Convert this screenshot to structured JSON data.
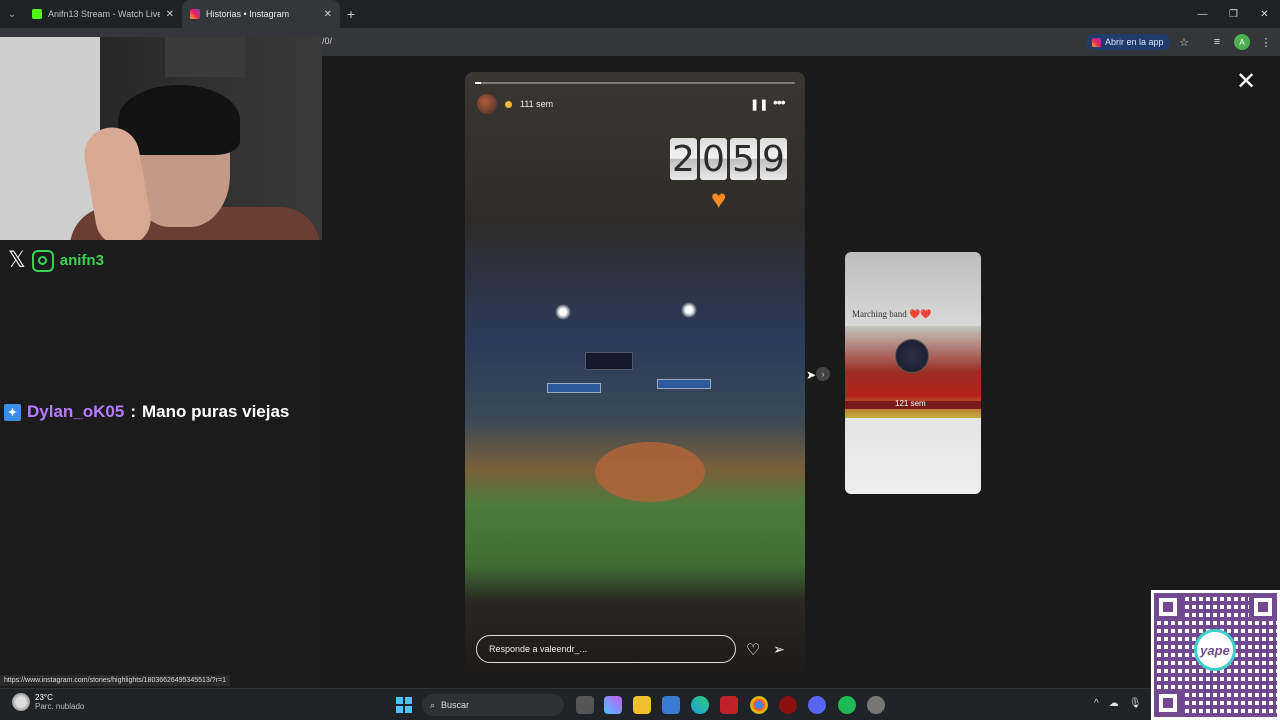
{
  "browser": {
    "tabs": [
      {
        "title": "Anifn13 Stream - Watch Live o",
        "favicon_color": "#53fc18"
      },
      {
        "title": "Historias • Instagram",
        "favicon_color": "#e6205f"
      }
    ],
    "url_fragment": "/0/",
    "open_app_label": "Abrir en la app",
    "profile_initial": "A"
  },
  "story": {
    "time_ago": "111 sem",
    "clock_digits": [
      "2",
      "0",
      "5",
      "9"
    ],
    "reply_placeholder": "Responde a valeendr_...",
    "progress": 0.02
  },
  "next_preview": {
    "caption": "Marching band ❤️❤️",
    "time_ago": "121 sem"
  },
  "stream_overlay": {
    "handle": "anifn3",
    "chat": {
      "user": "Dylan_oK05",
      "separator": ":",
      "message": "Mano puras viejas"
    }
  },
  "status_url": "https://www.instagram.com/stories/highlights/18036626495345513/?r=1",
  "taskbar": {
    "temperature": "23°C",
    "condition": "Parc. nublado",
    "search_label": "Buscar"
  },
  "colors": {
    "stream_green": "#39d353",
    "chat_user": "#b57cff",
    "qr_purple": "#5a2a7d"
  }
}
